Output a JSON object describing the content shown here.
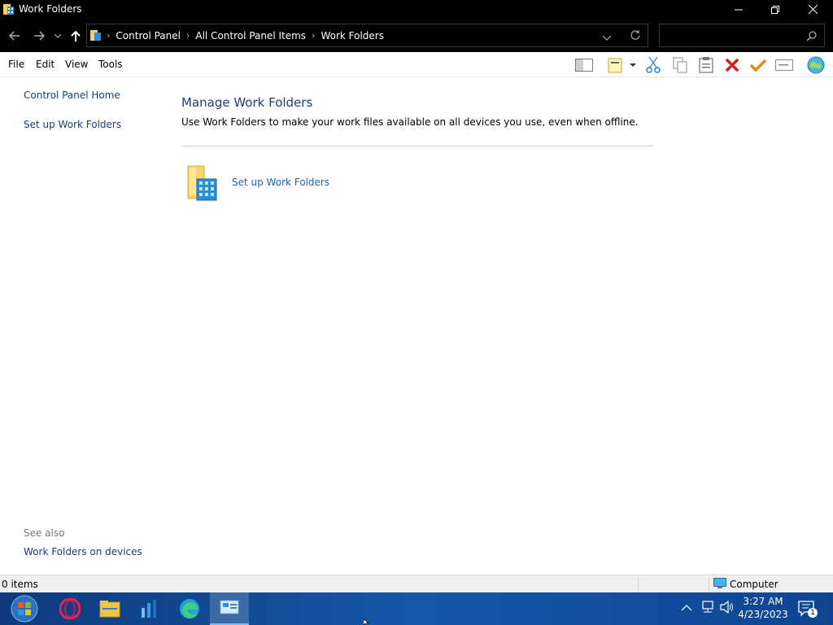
{
  "window": {
    "title": "Work Folders"
  },
  "address": {
    "crumbs": [
      "Control Panel",
      "All Control Panel Items",
      "Work Folders"
    ]
  },
  "menu": [
    "File",
    "Edit",
    "View",
    "Tools"
  ],
  "sidebar": {
    "items": [
      "Control Panel Home",
      "Set up Work Folders"
    ],
    "see_also_label": "See also",
    "see_also_items": [
      "Work Folders on devices"
    ]
  },
  "main": {
    "heading": "Manage Work Folders",
    "description": "Use Work Folders to make your work files available on all devices you use, even when offline.",
    "setup_link": "Set up Work Folders"
  },
  "status": {
    "items_count": "0 items",
    "zone": "Computer"
  },
  "taskbar": {
    "time": "3:27 AM",
    "date": "4/23/2023",
    "notification_count": "1"
  },
  "colors": {
    "link": "#1a3e6e",
    "heading": "#1e3e7a",
    "taskbar": "#1557a8"
  }
}
